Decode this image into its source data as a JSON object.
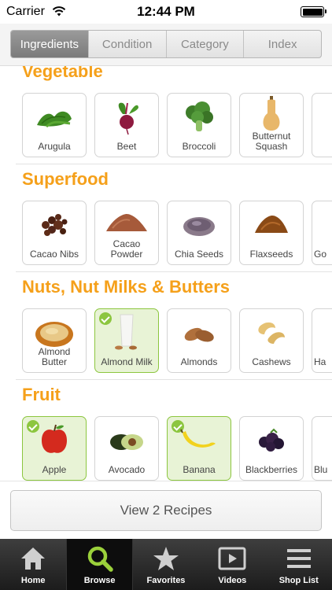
{
  "status_bar": {
    "carrier": "Carrier",
    "time": "12:44 PM"
  },
  "tabs_top": [
    "Ingredients",
    "Condition",
    "Category",
    "Index"
  ],
  "sections": [
    {
      "title": "Vegetable",
      "items": [
        {
          "label": "Arugula",
          "selected": false,
          "icon": "arugula-icon"
        },
        {
          "label": "Beet",
          "selected": false,
          "icon": "beet-icon"
        },
        {
          "label": "Broccoli",
          "selected": false,
          "icon": "broccoli-icon"
        },
        {
          "label": "Butternut Squash",
          "selected": false,
          "icon": "butternut-squash-icon"
        },
        {
          "label": "",
          "selected": false,
          "icon": "partial-item-icon"
        }
      ]
    },
    {
      "title": "Superfood",
      "items": [
        {
          "label": "Cacao Nibs",
          "selected": false,
          "icon": "cacao-nibs-icon"
        },
        {
          "label": "Cacao Powder",
          "selected": false,
          "icon": "cacao-powder-icon"
        },
        {
          "label": "Chia Seeds",
          "selected": false,
          "icon": "chia-seeds-icon"
        },
        {
          "label": "Flaxseeds",
          "selected": false,
          "icon": "flaxseeds-icon"
        },
        {
          "label": "Go",
          "selected": false,
          "icon": "partial-item-icon"
        }
      ]
    },
    {
      "title": "Nuts, Nut Milks & Butters",
      "items": [
        {
          "label": "Almond Butter",
          "selected": false,
          "icon": "almond-butter-icon"
        },
        {
          "label": "Almond Milk",
          "selected": true,
          "icon": "almond-milk-icon"
        },
        {
          "label": "Almonds",
          "selected": false,
          "icon": "almonds-icon"
        },
        {
          "label": "Cashews",
          "selected": false,
          "icon": "cashews-icon"
        },
        {
          "label": "Ha",
          "selected": false,
          "icon": "partial-item-icon"
        }
      ]
    },
    {
      "title": "Fruit",
      "items": [
        {
          "label": "Apple",
          "selected": true,
          "icon": "apple-icon"
        },
        {
          "label": "Avocado",
          "selected": false,
          "icon": "avocado-icon"
        },
        {
          "label": "Banana",
          "selected": true,
          "icon": "banana-icon"
        },
        {
          "label": "Blackberries",
          "selected": false,
          "icon": "blackberries-icon"
        },
        {
          "label": "Blu",
          "selected": false,
          "icon": "partial-item-icon"
        }
      ]
    }
  ],
  "view_recipes": "View 2 Recipes",
  "tabbar": [
    {
      "label": "Home",
      "icon": "home-icon"
    },
    {
      "label": "Browse",
      "icon": "search-icon",
      "active": true
    },
    {
      "label": "Favorites",
      "icon": "star-icon"
    },
    {
      "label": "Videos",
      "icon": "video-icon"
    },
    {
      "label": "Shop List",
      "icon": "list-icon"
    }
  ],
  "colors": {
    "section_title": "#f5a01a",
    "selected_border": "#8cc63f",
    "selected_bg": "#e8f3d6"
  }
}
